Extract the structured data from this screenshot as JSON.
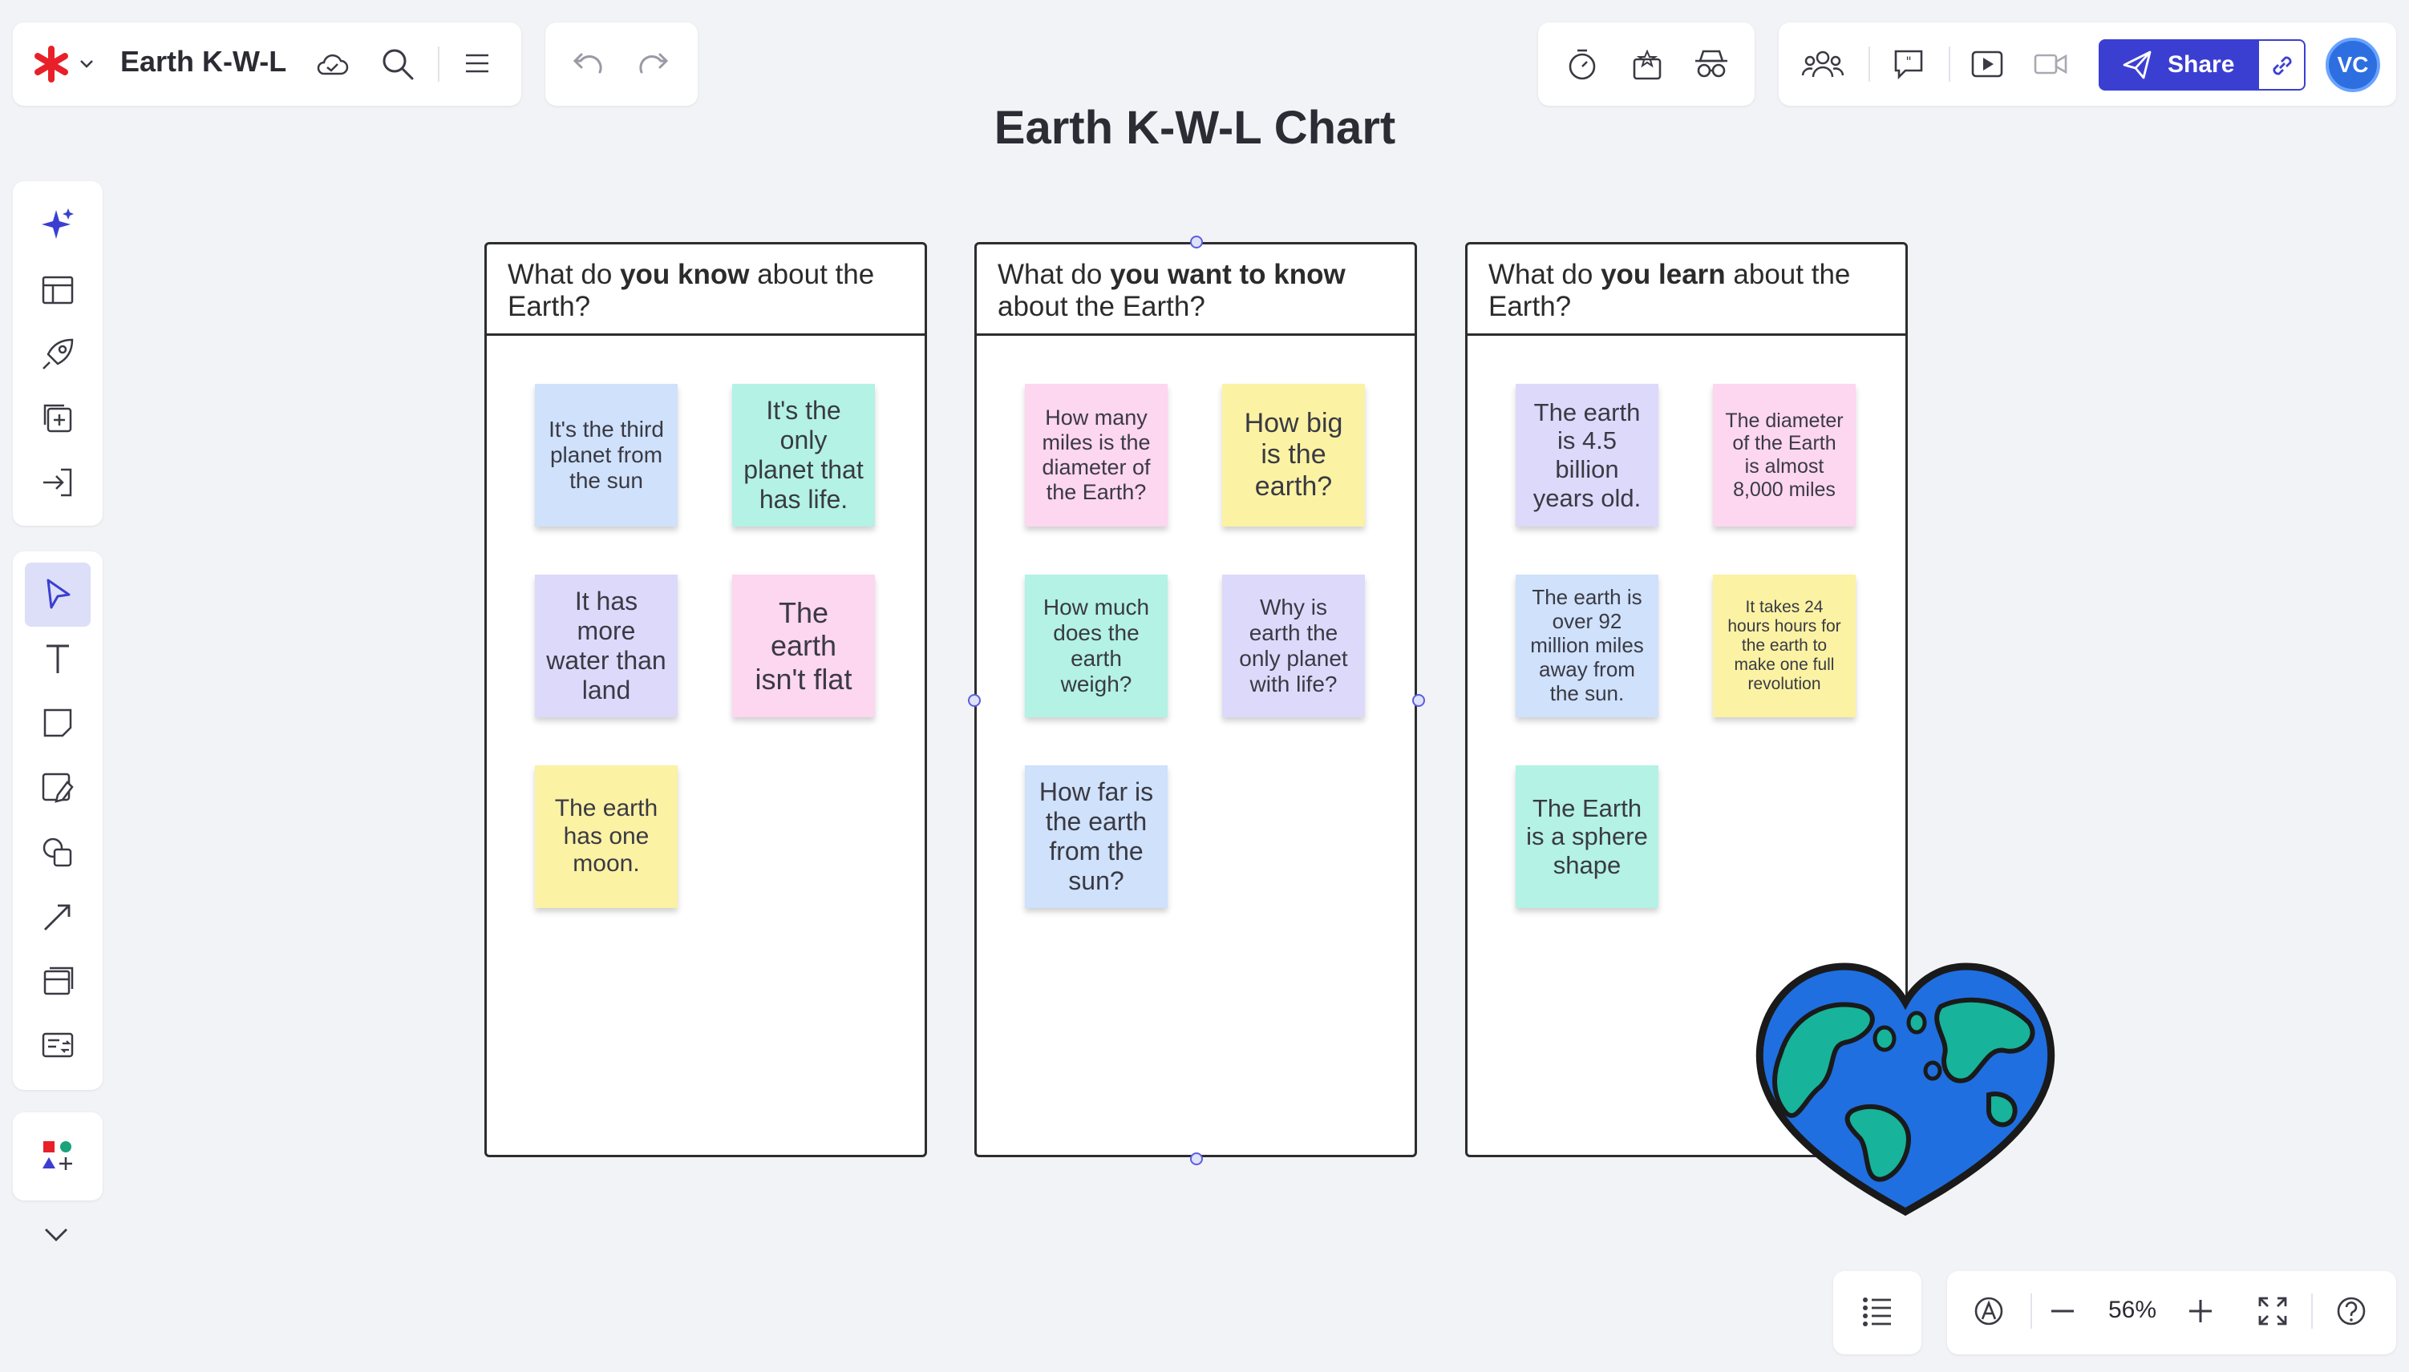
{
  "header": {
    "file_title": "Earth K-W-L",
    "share_label": "Share",
    "avatar_initials": "VC"
  },
  "board": {
    "title": "Earth K-W-L Chart",
    "columns": [
      {
        "heading_pre": "What do ",
        "heading_bold": "you know",
        "heading_post": " about the Earth?",
        "notes": [
          {
            "text": "It's the third planet from the sun",
            "color": "#cfe1fb"
          },
          {
            "text": "It's the only planet that has life.",
            "color": "#b3f2e5"
          },
          {
            "text": "It has more water than land",
            "color": "#ddd9fb"
          },
          {
            "text": "The earth isn't flat",
            "color": "#fdd6ef"
          },
          {
            "text": "The earth has one moon.",
            "color": "#fbf2a3"
          }
        ]
      },
      {
        "heading_pre": "What do ",
        "heading_bold": "you want to know",
        "heading_post": " about the Earth?",
        "notes": [
          {
            "text": "How many miles is the diameter of the Earth?",
            "color": "#fdd6ef"
          },
          {
            "text": "How big is the earth?",
            "color": "#fbf2a3"
          },
          {
            "text": "How much does the earth weigh?",
            "color": "#b3f2e5"
          },
          {
            "text": "Why is earth the only planet with life?",
            "color": "#ddd9fb"
          },
          {
            "text": "How far is the earth from the sun?",
            "color": "#cfe1fb"
          }
        ]
      },
      {
        "heading_pre": "What do ",
        "heading_bold": "you learn",
        "heading_post": " about the Earth?",
        "notes": [
          {
            "text": "The earth is 4.5 billion years old.",
            "color": "#ddd9fb"
          },
          {
            "text": "The diameter of the Earth is almost 8,000 miles",
            "color": "#fdd6ef"
          },
          {
            "text": "The earth is over 92 million miles away from the sun.",
            "color": "#cfe1fb"
          },
          {
            "text": "It takes 24 hours hours for the earth to make one full revolution",
            "color": "#fbf2a3"
          },
          {
            "text": "The Earth is a sphere shape",
            "color": "#b3f2e5"
          }
        ]
      }
    ]
  },
  "footer": {
    "zoom_level": "56%"
  },
  "colors": {
    "accent": "#3b3fd1",
    "brand": "#e8202a"
  },
  "icons": {
    "top_left": [
      "asterisk-logo-icon",
      "chevron-down-icon",
      "cloud-sync-icon",
      "search-icon",
      "menu-icon"
    ],
    "history": [
      "undo-icon",
      "redo-icon"
    ],
    "tools_top": [
      "timer-icon",
      "vote-icon",
      "incognito-icon"
    ],
    "collab": [
      "people-icon",
      "comment-icon",
      "present-icon",
      "video-icon",
      "link-icon"
    ],
    "left_toolbar": [
      "ai-sparkle-icon",
      "template-icon",
      "rocket-icon",
      "add-frame-icon",
      "import-icon",
      "select-pointer-icon",
      "text-icon",
      "sticky-note-icon",
      "pen-icon",
      "shapes-icon",
      "line-icon",
      "frame-icon",
      "card-icon",
      "more-apps-icon",
      "chevron-down-icon"
    ],
    "bottom": [
      "outline-list-icon",
      "pen-circle-icon",
      "zoom-out-icon",
      "zoom-in-icon",
      "fit-screen-icon",
      "help-icon"
    ],
    "sticker": "earth-heart-sticker"
  }
}
